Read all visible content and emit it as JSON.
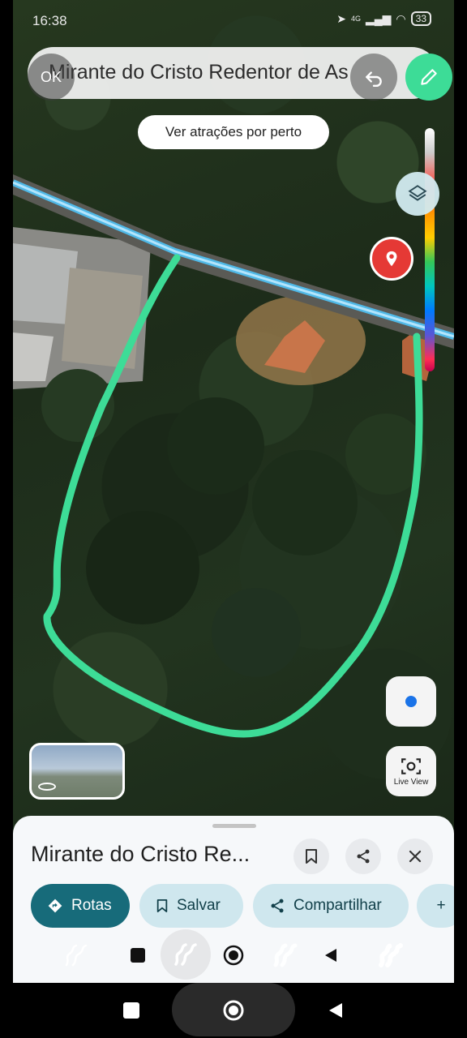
{
  "status_bar": {
    "time": "16:38",
    "network": "4G",
    "battery": "33"
  },
  "search": {
    "query": "Mirante do Cristo Redentor de As",
    "ok_label": "OK"
  },
  "nearby_chip": "Ver atrações por perto",
  "live_view_label": "Live View",
  "place": {
    "title": "Mirante do Cristo Re..."
  },
  "actions": {
    "routes": "Rotas",
    "save": "Salvar",
    "share": "Compartilhar",
    "more": "+"
  },
  "colors": {
    "drawing_stroke": "#3ddc97",
    "road": "#4fc3f7",
    "primary_chip": "#176b7a",
    "secondary_chip": "#cfe7ee",
    "pin": "#e53935"
  },
  "icons": {
    "undo": "undo-icon",
    "pencil": "pencil-icon",
    "layers": "layers-icon",
    "pin": "map-pin-icon",
    "location": "my-location-icon",
    "live_view": "camera-scan-icon"
  }
}
